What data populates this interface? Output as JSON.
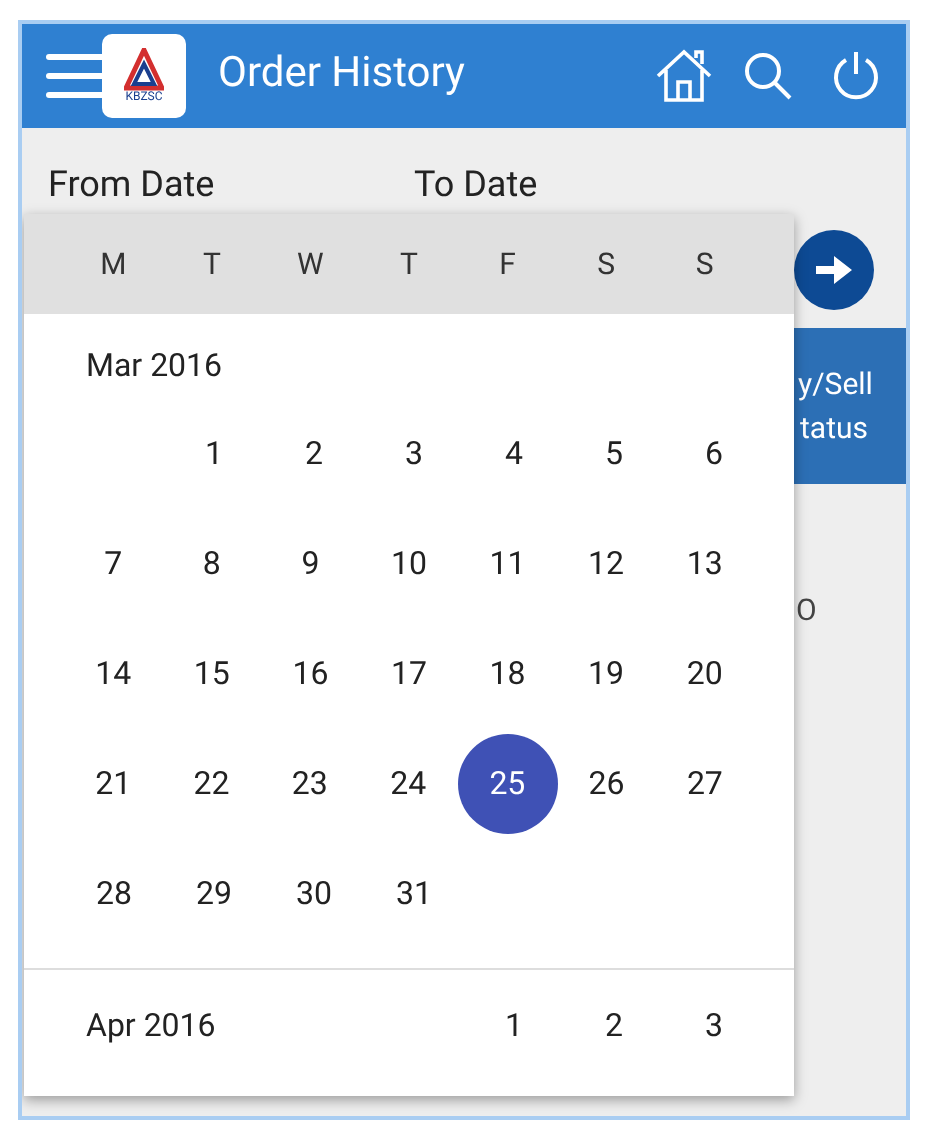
{
  "header": {
    "title": "Order History",
    "logo_text": "KBZSC"
  },
  "form": {
    "from_label": "From Date",
    "to_label": "To Date"
  },
  "background": {
    "column_heading": [
      "y/Sell",
      "tatus"
    ],
    "cell": "O"
  },
  "calendar": {
    "weekdays": [
      "M",
      "T",
      "W",
      "T",
      "F",
      "S",
      "S"
    ],
    "months": [
      {
        "label": "Mar 2016",
        "weeks": [
          {
            "kind": "leading",
            "days": [
              {
                "day": "1",
                "selected": false
              },
              {
                "day": "2",
                "selected": false
              },
              {
                "day": "3",
                "selected": false
              },
              {
                "day": "4",
                "selected": false
              },
              {
                "day": "5",
                "selected": false
              },
              {
                "day": "6",
                "selected": false
              }
            ]
          },
          {
            "kind": "full",
            "days": [
              {
                "day": "7",
                "selected": false
              },
              {
                "day": "8",
                "selected": false
              },
              {
                "day": "9",
                "selected": false
              },
              {
                "day": "10",
                "selected": false
              },
              {
                "day": "11",
                "selected": false
              },
              {
                "day": "12",
                "selected": false
              },
              {
                "day": "13",
                "selected": false
              }
            ]
          },
          {
            "kind": "full",
            "days": [
              {
                "day": "14",
                "selected": false
              },
              {
                "day": "15",
                "selected": false
              },
              {
                "day": "16",
                "selected": false
              },
              {
                "day": "17",
                "selected": false
              },
              {
                "day": "18",
                "selected": false
              },
              {
                "day": "19",
                "selected": false
              },
              {
                "day": "20",
                "selected": false
              }
            ]
          },
          {
            "kind": "full",
            "days": [
              {
                "day": "21",
                "selected": false
              },
              {
                "day": "22",
                "selected": false
              },
              {
                "day": "23",
                "selected": false
              },
              {
                "day": "24",
                "selected": false
              },
              {
                "day": "25",
                "selected": true
              },
              {
                "day": "26",
                "selected": false
              },
              {
                "day": "27",
                "selected": false
              }
            ]
          },
          {
            "kind": "trailing",
            "days": [
              {
                "day": "28",
                "selected": false
              },
              {
                "day": "29",
                "selected": false
              },
              {
                "day": "30",
                "selected": false
              },
              {
                "day": "31",
                "selected": false
              }
            ]
          }
        ]
      },
      {
        "label": "Apr 2016",
        "weeks": [
          {
            "kind": "leading",
            "days": [
              {
                "day": "1",
                "selected": false
              },
              {
                "day": "2",
                "selected": false
              },
              {
                "day": "3",
                "selected": false
              }
            ]
          }
        ]
      }
    ]
  }
}
